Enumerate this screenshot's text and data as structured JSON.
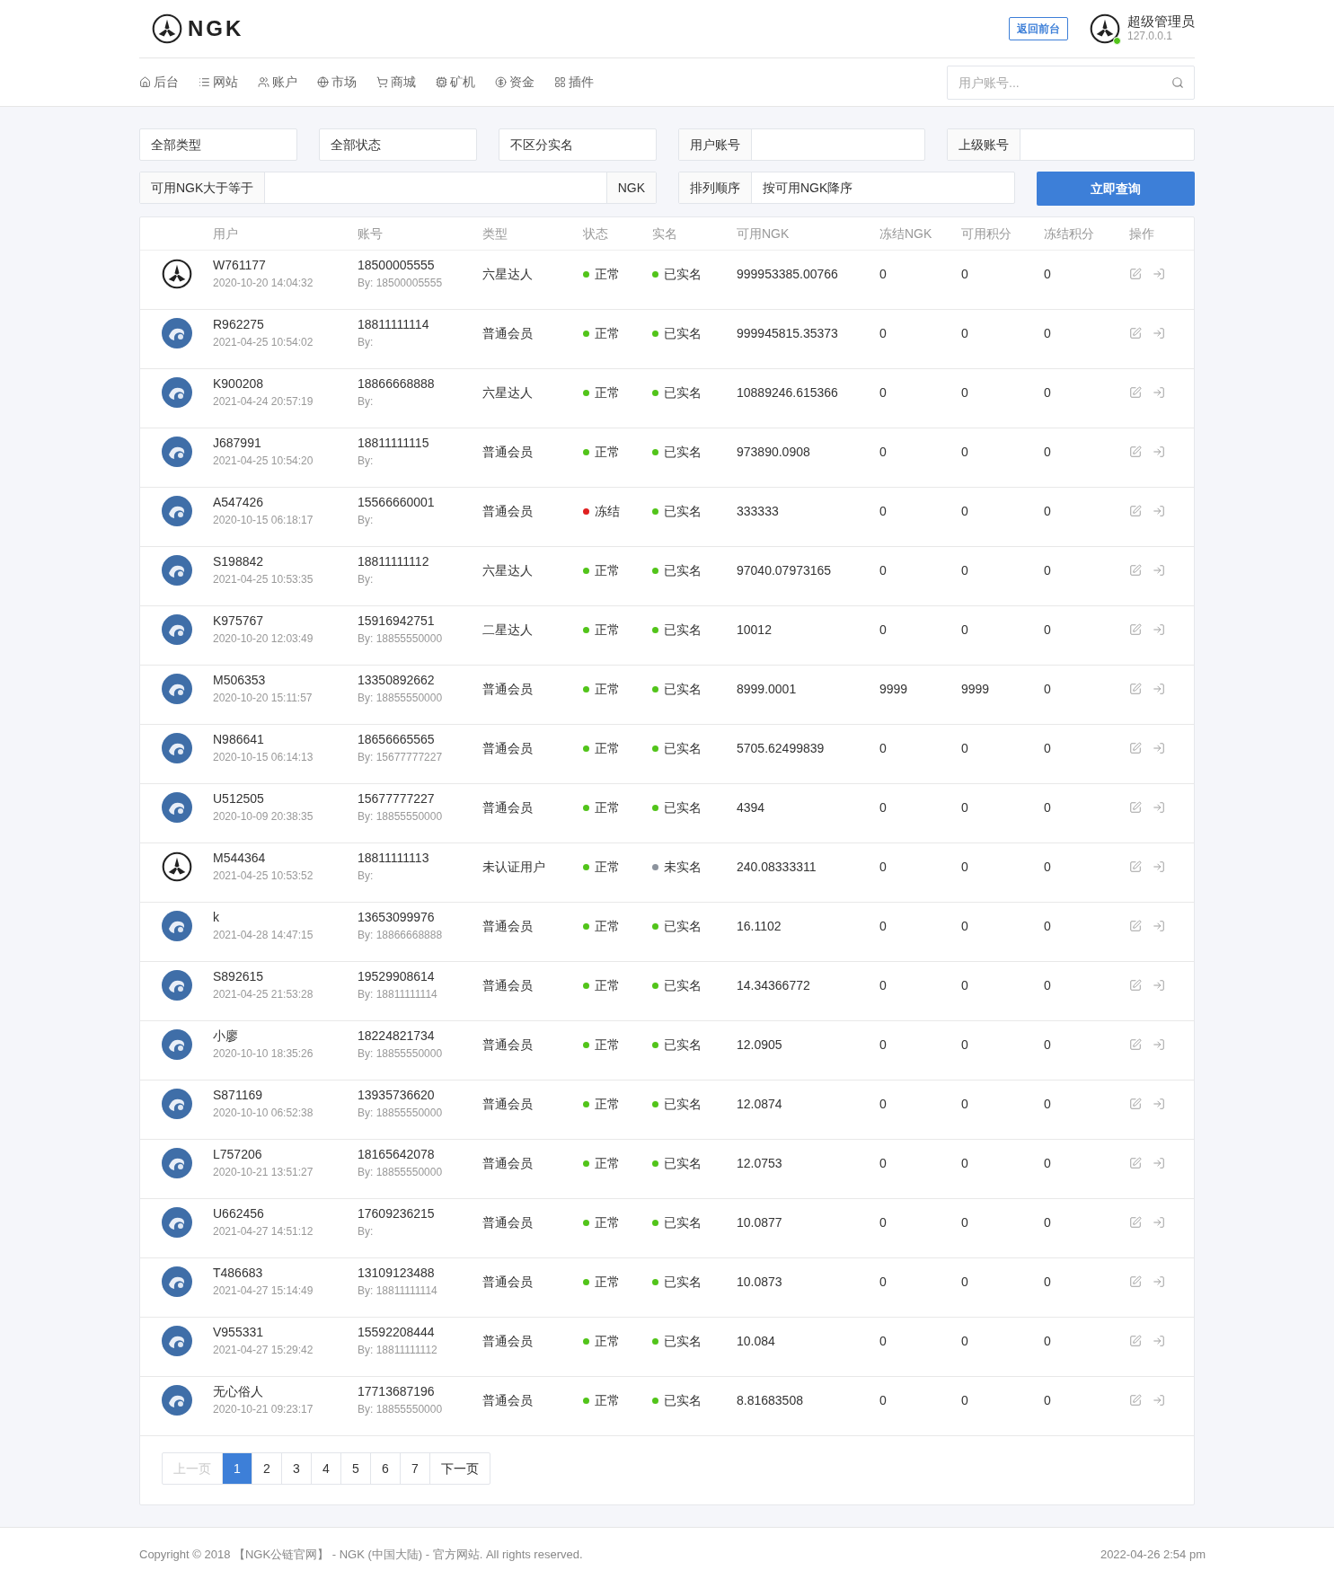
{
  "header": {
    "logo_text": "NGK",
    "frontend_button": "返回前台",
    "user_name": "超级管理员",
    "user_ip": "127.0.0.1",
    "online": true
  },
  "nav": {
    "items": [
      {
        "label": "后台"
      },
      {
        "label": "网站"
      },
      {
        "label": "账户"
      },
      {
        "label": "市场"
      },
      {
        "label": "商城"
      },
      {
        "label": "矿机"
      },
      {
        "label": "资金"
      },
      {
        "label": "插件"
      }
    ],
    "search_placeholder": "用户账号..."
  },
  "filters": {
    "type": "全部类型",
    "status": "全部状态",
    "realname": "不区分实名",
    "account_label": "用户账号",
    "parent_label": "上级账号",
    "min_label": "可用NGK大于等于",
    "min_unit": "NGK",
    "sort_label": "排列顺序",
    "sort_value": "按可用NGK降序",
    "submit": "立即查询"
  },
  "table": {
    "columns": [
      "用户",
      "账号",
      "类型",
      "状态",
      "实名",
      "可用NGK",
      "冻结NGK",
      "可用积分",
      "冻结积分",
      "操作"
    ],
    "rows": [
      {
        "kind": "logo",
        "user": "W761177",
        "time": "2020-10-20 14:04:32",
        "account": "18500005555",
        "by": "By: 18500005555",
        "type": "六星达人",
        "status": {
          "label": "正常",
          "color": "#52c41a"
        },
        "realname": {
          "label": "已实名",
          "color": "#52c41a"
        },
        "ngk": "999953385.00766",
        "frozen_ngk": "0",
        "points": "0",
        "frozen_points": "0"
      },
      {
        "kind": "photo",
        "user": "R962275",
        "time": "2021-04-25 10:54:02",
        "account": "18811111114",
        "by": "By:",
        "type": "普通会员",
        "status": {
          "label": "正常",
          "color": "#52c41a"
        },
        "realname": {
          "label": "已实名",
          "color": "#52c41a"
        },
        "ngk": "999945815.35373",
        "frozen_ngk": "0",
        "points": "0",
        "frozen_points": "0"
      },
      {
        "kind": "photo",
        "user": "K900208",
        "time": "2021-04-24 20:57:19",
        "account": "18866668888",
        "by": "By:",
        "type": "六星达人",
        "status": {
          "label": "正常",
          "color": "#52c41a"
        },
        "realname": {
          "label": "已实名",
          "color": "#52c41a"
        },
        "ngk": "10889246.615366",
        "frozen_ngk": "0",
        "points": "0",
        "frozen_points": "0"
      },
      {
        "kind": "photo",
        "user": "J687991",
        "time": "2021-04-25 10:54:20",
        "account": "18811111115",
        "by": "By:",
        "type": "普通会员",
        "status": {
          "label": "正常",
          "color": "#52c41a"
        },
        "realname": {
          "label": "已实名",
          "color": "#52c41a"
        },
        "ngk": "973890.0908",
        "frozen_ngk": "0",
        "points": "0",
        "frozen_points": "0"
      },
      {
        "kind": "photo",
        "user": "A547426",
        "time": "2020-10-15 06:18:17",
        "account": "15566660001",
        "by": "By:",
        "type": "普通会员",
        "status": {
          "label": "冻结",
          "color": "#e02020"
        },
        "realname": {
          "label": "已实名",
          "color": "#52c41a"
        },
        "ngk": "333333",
        "frozen_ngk": "0",
        "points": "0",
        "frozen_points": "0"
      },
      {
        "kind": "photo",
        "user": "S198842",
        "time": "2021-04-25 10:53:35",
        "account": "18811111112",
        "by": "By:",
        "type": "六星达人",
        "status": {
          "label": "正常",
          "color": "#52c41a"
        },
        "realname": {
          "label": "已实名",
          "color": "#52c41a"
        },
        "ngk": "97040.07973165",
        "frozen_ngk": "0",
        "points": "0",
        "frozen_points": "0"
      },
      {
        "kind": "photo",
        "user": "K975767",
        "time": "2020-10-20 12:03:49",
        "account": "15916942751",
        "by": "By: 18855550000",
        "type": "二星达人",
        "status": {
          "label": "正常",
          "color": "#52c41a"
        },
        "realname": {
          "label": "已实名",
          "color": "#52c41a"
        },
        "ngk": "10012",
        "frozen_ngk": "0",
        "points": "0",
        "frozen_points": "0"
      },
      {
        "kind": "photo",
        "user": "M506353",
        "time": "2020-10-20 15:11:57",
        "account": "13350892662",
        "by": "By: 18855550000",
        "type": "普通会员",
        "status": {
          "label": "正常",
          "color": "#52c41a"
        },
        "realname": {
          "label": "已实名",
          "color": "#52c41a"
        },
        "ngk": "8999.0001",
        "frozen_ngk": "9999",
        "points": "9999",
        "frozen_points": "0"
      },
      {
        "kind": "photo",
        "user": "N986641",
        "time": "2020-10-15 06:14:13",
        "account": "18656665565",
        "by": "By: 15677777227",
        "type": "普通会员",
        "status": {
          "label": "正常",
          "color": "#52c41a"
        },
        "realname": {
          "label": "已实名",
          "color": "#52c41a"
        },
        "ngk": "5705.62499839",
        "frozen_ngk": "0",
        "points": "0",
        "frozen_points": "0"
      },
      {
        "kind": "photo",
        "user": "U512505",
        "time": "2020-10-09 20:38:35",
        "account": "15677777227",
        "by": "By: 18855550000",
        "type": "普通会员",
        "status": {
          "label": "正常",
          "color": "#52c41a"
        },
        "realname": {
          "label": "已实名",
          "color": "#52c41a"
        },
        "ngk": "4394",
        "frozen_ngk": "0",
        "points": "0",
        "frozen_points": "0"
      },
      {
        "kind": "logo",
        "user": "M544364",
        "time": "2021-04-25 10:53:52",
        "account": "18811111113",
        "by": "By:",
        "type": "未认证用户",
        "status": {
          "label": "正常",
          "color": "#52c41a"
        },
        "realname": {
          "label": "未实名",
          "color": "#8c939d"
        },
        "ngk": "240.08333311",
        "frozen_ngk": "0",
        "points": "0",
        "frozen_points": "0"
      },
      {
        "kind": "photo",
        "user": "k",
        "time": "2021-04-28 14:47:15",
        "account": "13653099976",
        "by": "By: 18866668888",
        "type": "普通会员",
        "status": {
          "label": "正常",
          "color": "#52c41a"
        },
        "realname": {
          "label": "已实名",
          "color": "#52c41a"
        },
        "ngk": "16.1102",
        "frozen_ngk": "0",
        "points": "0",
        "frozen_points": "0"
      },
      {
        "kind": "photo",
        "user": "S892615",
        "time": "2021-04-25 21:53:28",
        "account": "19529908614",
        "by": "By: 18811111114",
        "type": "普通会员",
        "status": {
          "label": "正常",
          "color": "#52c41a"
        },
        "realname": {
          "label": "已实名",
          "color": "#52c41a"
        },
        "ngk": "14.34366772",
        "frozen_ngk": "0",
        "points": "0",
        "frozen_points": "0"
      },
      {
        "kind": "photo",
        "user": "小廖",
        "time": "2020-10-10 18:35:26",
        "account": "18224821734",
        "by": "By: 18855550000",
        "type": "普通会员",
        "status": {
          "label": "正常",
          "color": "#52c41a"
        },
        "realname": {
          "label": "已实名",
          "color": "#52c41a"
        },
        "ngk": "12.0905",
        "frozen_ngk": "0",
        "points": "0",
        "frozen_points": "0"
      },
      {
        "kind": "photo",
        "user": "S871169",
        "time": "2020-10-10 06:52:38",
        "account": "13935736620",
        "by": "By: 18855550000",
        "type": "普通会员",
        "status": {
          "label": "正常",
          "color": "#52c41a"
        },
        "realname": {
          "label": "已实名",
          "color": "#52c41a"
        },
        "ngk": "12.0874",
        "frozen_ngk": "0",
        "points": "0",
        "frozen_points": "0"
      },
      {
        "kind": "photo",
        "user": "L757206",
        "time": "2020-10-21 13:51:27",
        "account": "18165642078",
        "by": "By: 18855550000",
        "type": "普通会员",
        "status": {
          "label": "正常",
          "color": "#52c41a"
        },
        "realname": {
          "label": "已实名",
          "color": "#52c41a"
        },
        "ngk": "12.0753",
        "frozen_ngk": "0",
        "points": "0",
        "frozen_points": "0"
      },
      {
        "kind": "photo",
        "user": "U662456",
        "time": "2021-04-27 14:51:12",
        "account": "17609236215",
        "by": "By:",
        "type": "普通会员",
        "status": {
          "label": "正常",
          "color": "#52c41a"
        },
        "realname": {
          "label": "已实名",
          "color": "#52c41a"
        },
        "ngk": "10.0877",
        "frozen_ngk": "0",
        "points": "0",
        "frozen_points": "0"
      },
      {
        "kind": "photo",
        "user": "T486683",
        "time": "2021-04-27 15:14:49",
        "account": "13109123488",
        "by": "By: 18811111114",
        "type": "普通会员",
        "status": {
          "label": "正常",
          "color": "#52c41a"
        },
        "realname": {
          "label": "已实名",
          "color": "#52c41a"
        },
        "ngk": "10.0873",
        "frozen_ngk": "0",
        "points": "0",
        "frozen_points": "0"
      },
      {
        "kind": "photo",
        "user": "V955331",
        "time": "2021-04-27 15:29:42",
        "account": "15592208444",
        "by": "By: 18811111112",
        "type": "普通会员",
        "status": {
          "label": "正常",
          "color": "#52c41a"
        },
        "realname": {
          "label": "已实名",
          "color": "#52c41a"
        },
        "ngk": "10.084",
        "frozen_ngk": "0",
        "points": "0",
        "frozen_points": "0"
      },
      {
        "kind": "photo",
        "user": "无心俗人",
        "time": "2020-10-21 09:23:17",
        "account": "17713687196",
        "by": "By: 18855550000",
        "type": "普通会员",
        "status": {
          "label": "正常",
          "color": "#52c41a"
        },
        "realname": {
          "label": "已实名",
          "color": "#52c41a"
        },
        "ngk": "8.81683508",
        "frozen_ngk": "0",
        "points": "0",
        "frozen_points": "0"
      }
    ]
  },
  "pagination": {
    "prev": {
      "label": "上一页",
      "disabled": true
    },
    "pages": [
      {
        "label": "1",
        "selected": true
      },
      {
        "label": "2",
        "selected": false
      },
      {
        "label": "3",
        "selected": false
      },
      {
        "label": "4",
        "selected": false
      },
      {
        "label": "5",
        "selected": false
      },
      {
        "label": "6",
        "selected": false
      },
      {
        "label": "7",
        "selected": false
      }
    ],
    "next": {
      "label": "下一页",
      "disabled": false
    }
  },
  "footer": {
    "copyright": "Copyright © 2018 【NGK公链官网】 - NGK (中国大陆) - 官方网站. All rights reserved.",
    "datetime": "2022-04-26 2:54 pm"
  }
}
